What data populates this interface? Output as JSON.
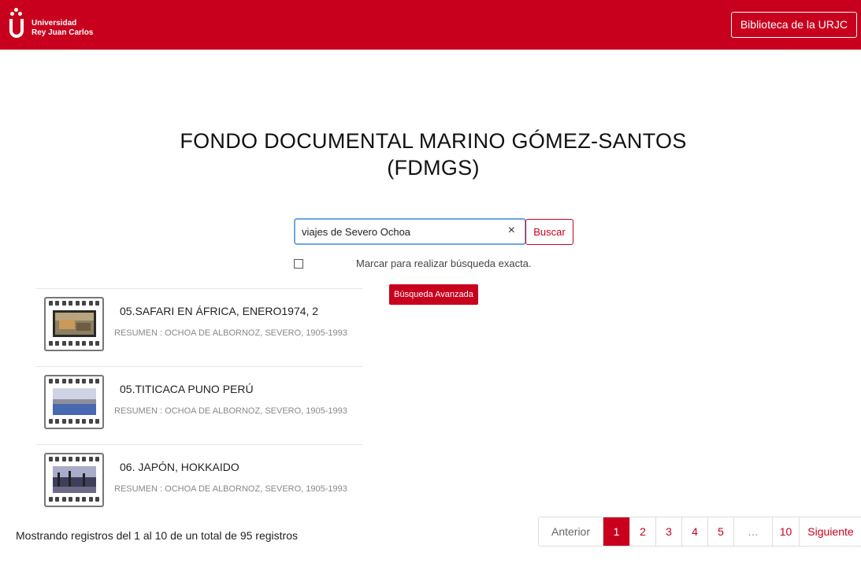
{
  "header": {
    "logo_line1": "Universidad",
    "logo_line2": "Rey Juan Carlos",
    "library_button": "Biblioteca de la URJC"
  },
  "hero": {
    "title_line1": "FONDO DOCUMENTAL MARINO GÓMEZ-SANTOS",
    "title_line2": "(FDMGS)"
  },
  "search": {
    "value": "viajes de Severo Ochoa",
    "clear_icon": "×",
    "submit_label": "Buscar",
    "exact_label": "Marcar para realizar búsqueda exacta.",
    "advanced_label": "Búsqueda Avanzada"
  },
  "results": [
    {
      "title": "05.SAFARI EN ÁFRICA, ENERO1974, 2",
      "summary": "RESUMEN : OCHOA DE ALBORNOZ, SEVERO, 1905-1993"
    },
    {
      "title": "05.TITICACA PUNO PERÚ",
      "summary": "RESUMEN : OCHOA DE ALBORNOZ, SEVERO, 1905-1993"
    },
    {
      "title": "06. JAPÓN, HOKKAIDO",
      "summary": "RESUMEN : OCHOA DE ALBORNOZ, SEVERO, 1905-1993"
    }
  ],
  "footer": {
    "count_text": "Mostrando registros del 1 al 10 de un total de 95 registros"
  },
  "pagination": {
    "prev": "Anterior",
    "pages": [
      "1",
      "2",
      "3",
      "4",
      "5"
    ],
    "ellipsis": "…",
    "last": "10",
    "next": "Siguiente",
    "current": "1"
  },
  "colors": {
    "brand": "#c8001e",
    "focus": "#6aa6df"
  }
}
